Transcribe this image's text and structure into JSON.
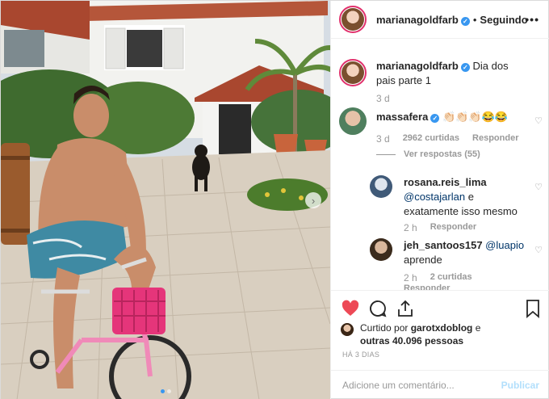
{
  "header": {
    "username": "marianagoldfarb",
    "separator": "•",
    "follow_status": "Seguindo",
    "more": "•••"
  },
  "caption": {
    "username": "marianagoldfarb",
    "text": "Dia dos pais parte 1",
    "time": "3 d"
  },
  "comments": [
    {
      "username": "massafera",
      "text": "👏🏻👏🏻👏🏻😂😂",
      "time": "3 d",
      "likes": "2962 curtidas",
      "reply": "Responder",
      "view_replies": "Ver respostas (55)"
    }
  ],
  "replies": [
    {
      "username": "rosana.reis_lima",
      "mention": "@costajarlan",
      "text": " e exatamente isso mesmo",
      "time": "2 h",
      "reply": "Responder"
    },
    {
      "username": "jeh_santoos157",
      "mention": "@luapio",
      "text": "aprende",
      "time": "2 h",
      "likes": "2 curtidas",
      "reply": "Responder"
    }
  ],
  "likes": {
    "prefix": "Curtido por",
    "user": "garotxdoblog",
    "middle": " e",
    "count": "outras 40.096 pessoas"
  },
  "date": "HÁ 3 DIAS",
  "comment_input": {
    "placeholder": "Adicione um comentário..."
  },
  "publish_label": "Publicar",
  "icons": {
    "verified": "verified-badge-icon",
    "heart_filled": "heart-filled-icon",
    "comment": "comment-bubble-icon",
    "share": "share-icon",
    "bookmark": "bookmark-icon",
    "next": "chevron-right-icon"
  },
  "carousel": {
    "slides": 2,
    "active": 1
  },
  "colors": {
    "accent": "#3897f0",
    "heart": "#ed4956",
    "publish_disabled": "#b2dffc"
  }
}
